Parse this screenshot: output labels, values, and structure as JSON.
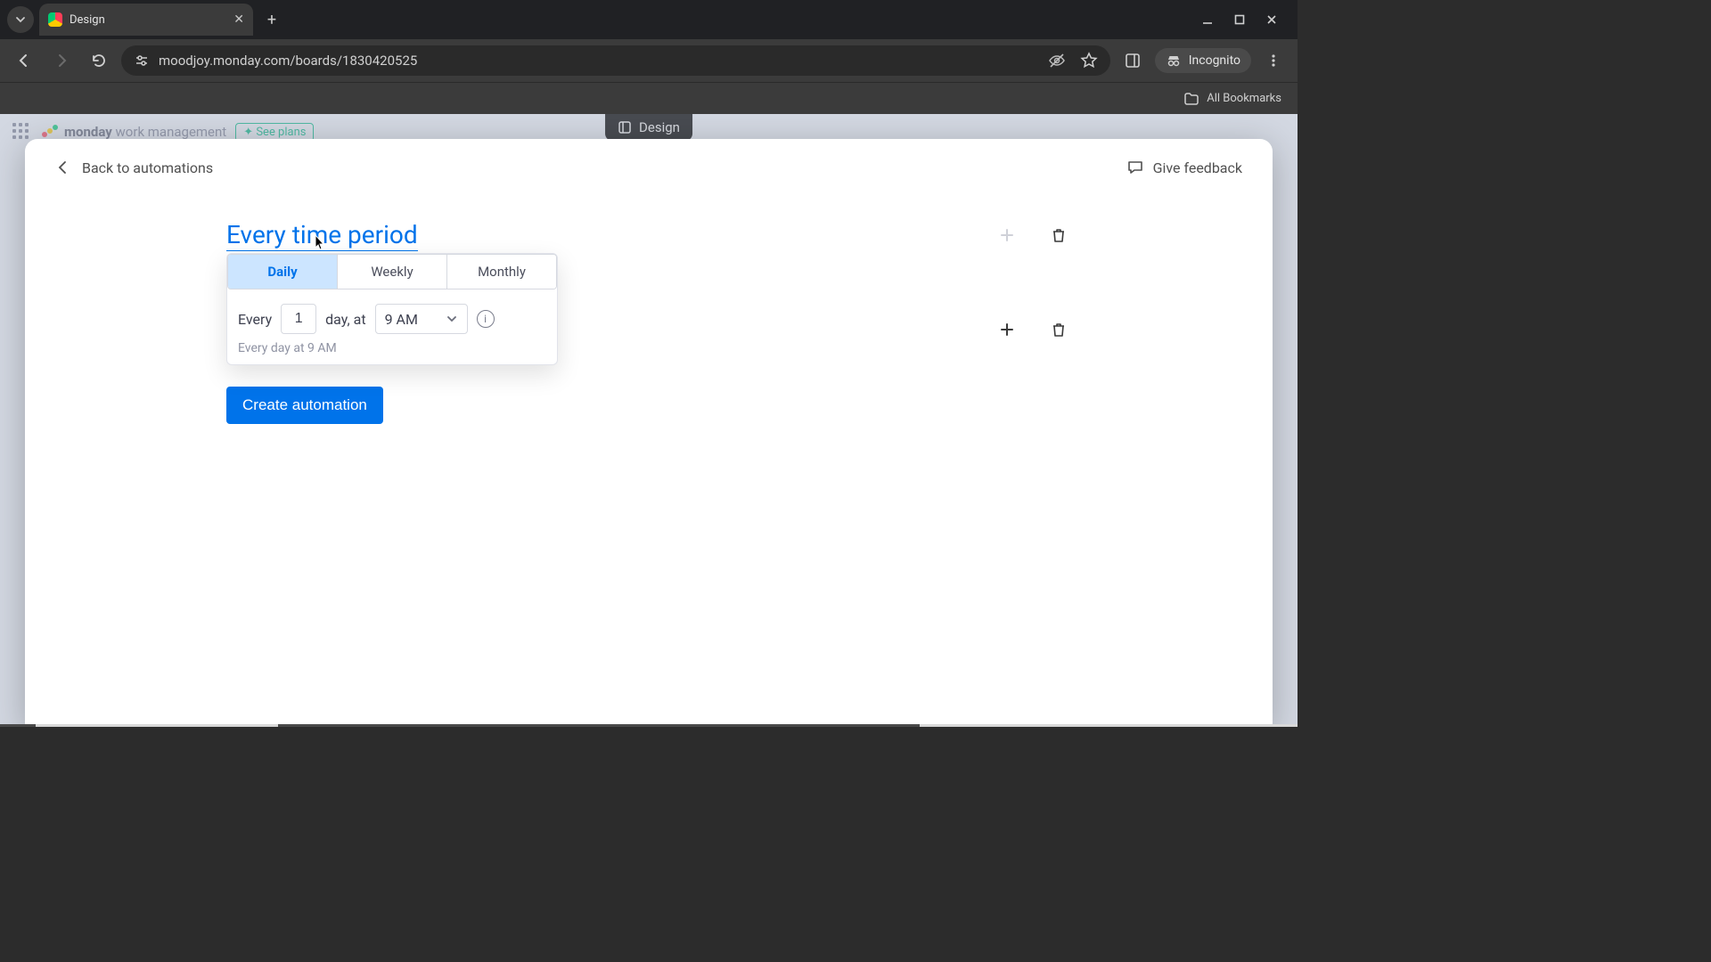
{
  "browser": {
    "tab_title": "Design",
    "url": "moodjoy.monday.com/boards/1830420525",
    "incognito_label": "Incognito",
    "bookmarks_label": "All Bookmarks"
  },
  "page_pill": {
    "label": "Design"
  },
  "monday_header": {
    "brand_bold": "monday",
    "brand_rest": "work management",
    "see_plans": "See plans"
  },
  "modal": {
    "back_label": "Back to automations",
    "feedback_label": "Give feedback",
    "heading": "Every time period",
    "segments": {
      "daily": "Daily",
      "weekly": "Weekly",
      "monthly": "Monthly"
    },
    "every_label": "Every",
    "day_at_label": "day, at",
    "interval_value": "1",
    "time_value": "9 AM",
    "summary": "Every day at 9 AM",
    "create_button": "Create automation"
  }
}
